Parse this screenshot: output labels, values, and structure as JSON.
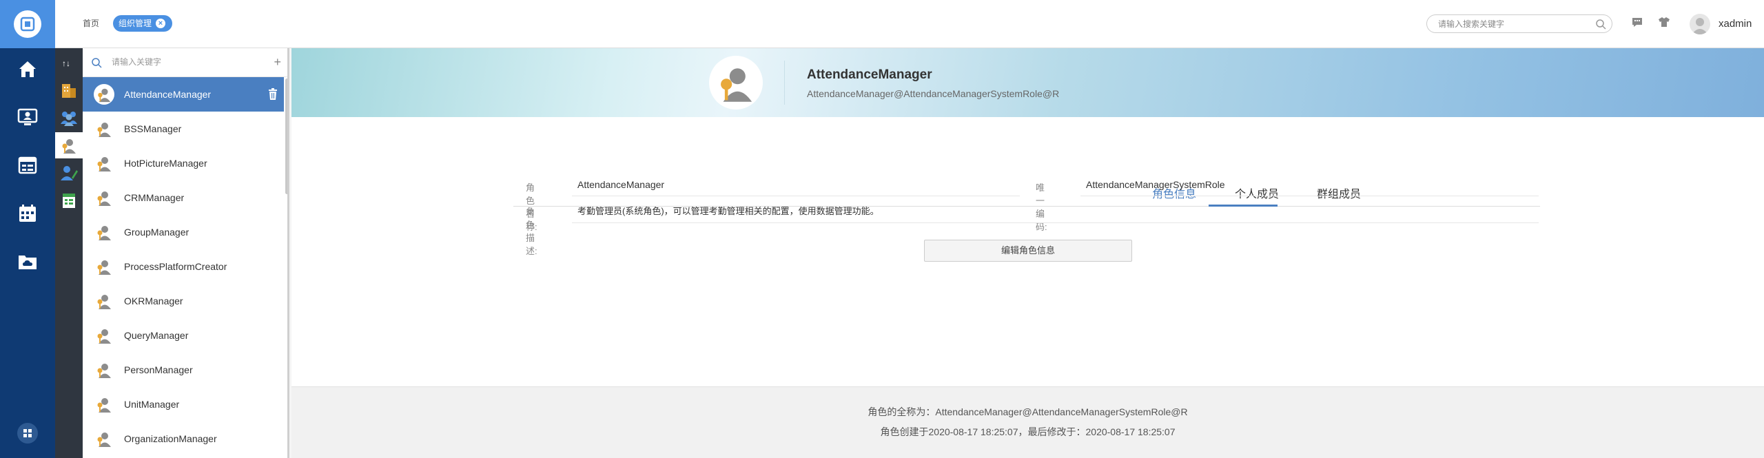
{
  "header": {
    "tabs": [
      {
        "label": "首页"
      },
      {
        "label": "组织管理"
      }
    ],
    "search": {
      "placeholder": "请输入搜索关键字",
      "icon": "search-icon"
    },
    "user": {
      "name": "xadmin"
    }
  },
  "list": {
    "search_placeholder": "请输入关键字",
    "items": [
      {
        "label": "AttendanceManager"
      },
      {
        "label": "BSSManager"
      },
      {
        "label": "HotPictureManager"
      },
      {
        "label": "CRMManager"
      },
      {
        "label": "GroupManager"
      },
      {
        "label": "ProcessPlatformCreator"
      },
      {
        "label": "OKRManager"
      },
      {
        "label": "QueryManager"
      },
      {
        "label": "PersonManager"
      },
      {
        "label": "UnitManager"
      },
      {
        "label": "OrganizationManager"
      }
    ]
  },
  "detail": {
    "name": "AttendanceManager",
    "distinguished_name": "AttendanceManager@AttendanceManagerSystemRole@R",
    "tabs": [
      {
        "label": "角色信息"
      },
      {
        "label": "个人成员"
      },
      {
        "label": "群组成员"
      }
    ],
    "fields": {
      "name_label": "角色名称:",
      "name_value": "AttendanceManager",
      "unique_label": "唯一编码:",
      "unique_value": "AttendanceManagerSystemRole",
      "desc_label": "角色描述:",
      "desc_value": "考勤管理员(系统角色)，可以管理考勤管理相关的配置，使用数据管理功能。"
    },
    "edit_button": "编辑角色信息",
    "footer": {
      "line1": "角色的全称为：AttendanceManager@AttendanceManagerSystemRole@R",
      "line2": "角色创建于2020-08-17 18:25:07，最后修改于：2020-08-17 18:25:07"
    }
  },
  "colors": {
    "rail": "#0f3a73",
    "accent": "#4a90e2",
    "active_item": "#4a7fc1"
  }
}
